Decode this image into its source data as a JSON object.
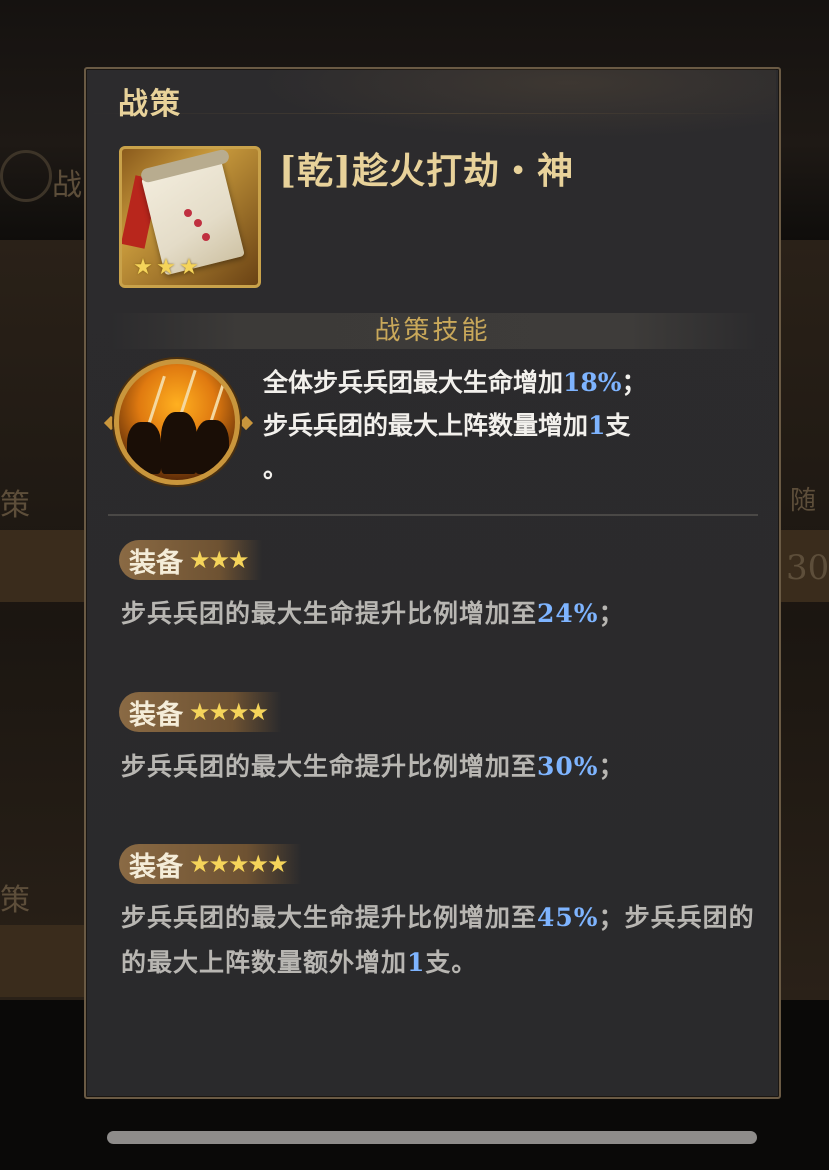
{
  "background": {
    "left_labels": [
      "战",
      "策",
      "策"
    ],
    "right_labels": [
      "随",
      "30"
    ]
  },
  "panel": {
    "title": "战策",
    "item": {
      "name": "[乾]趁火打劫・神",
      "icon": "scroll-icon",
      "star_count": 3
    },
    "skill_section": {
      "title": "战策技能",
      "icon": "soldiers-fire-icon",
      "description": {
        "line1_text": "全体步兵兵团最大生命增加",
        "line1_value": "18%",
        "line1_tail": "；",
        "line2_text": "步兵兵团的最大上阵数量增加",
        "line2_value": "1",
        "line2_tail": "支",
        "line3_text": "。"
      }
    },
    "tiers": [
      {
        "label": "装备",
        "stars": "★★★",
        "text_before": "步兵兵团的最大生命提升比例增加至",
        "value": "24%",
        "text_after": "；"
      },
      {
        "label": "装备",
        "stars": "★★★★",
        "text_before": "步兵兵团的最大生命提升比例增加至",
        "value": "30%",
        "text_after": "；"
      },
      {
        "label": "装备",
        "stars": "★★★★★",
        "text_before": "步兵兵团的最大生命提升比例增加至",
        "value": "45%",
        "text_after": "；步兵兵团的的最大上阵数量额外增加",
        "value2": "1",
        "text_after2": "支。"
      }
    ]
  },
  "colors": {
    "title_gold": "#e8d29a",
    "highlight_blue": "#7eb4ff",
    "star_yellow": "#f5d45a"
  }
}
